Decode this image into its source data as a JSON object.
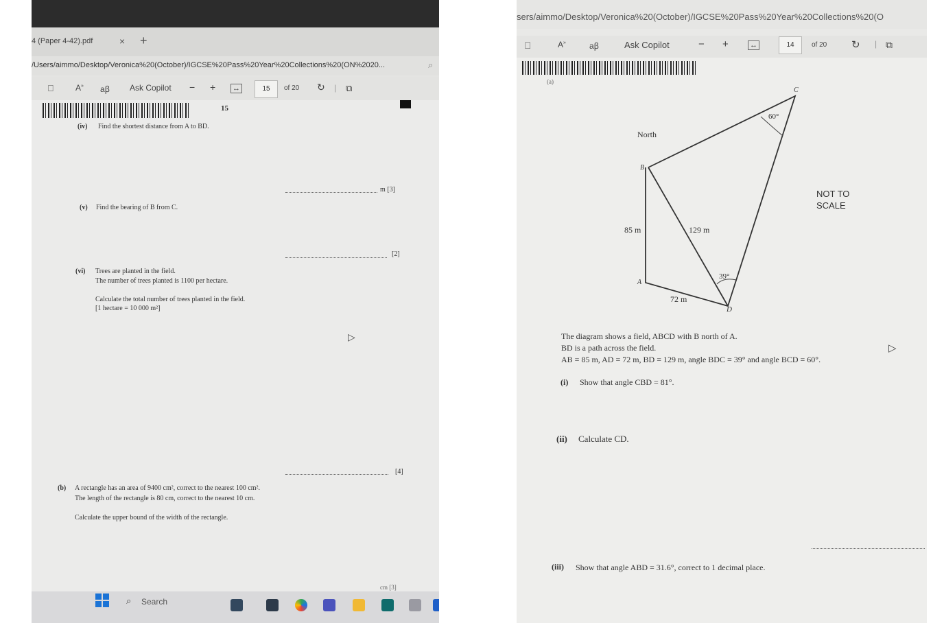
{
  "left": {
    "tab_title": "4 (Paper 4-42).pdf",
    "tab_close": "×",
    "new_tab": "+",
    "url": "/Users/aimmo/Desktop/Veronica%20(October)/IGCSE%20Pass%20Year%20Collections%20(ON%2020...",
    "toolbar": {
      "ask_copilot": "Ask Copilot",
      "zoom_out": "−",
      "zoom_in": "+",
      "page": "15",
      "of_pages": "of 20"
    },
    "page_number": "15",
    "q_iv_label": "(iv)",
    "q_iv_text": "Find the shortest distance from A to BD.",
    "q_iv_unit_marks": "m  [3]",
    "q_v_label": "(v)",
    "q_v_text": "Find the bearing of B from C.",
    "q_v_marks": "[2]",
    "q_vi_label": "(vi)",
    "q_vi_line1": "Trees are planted in the field.",
    "q_vi_line2": "The number of trees planted is 1100 per hectare.",
    "q_vi_line3": "Calculate the total number of trees planted in the field.",
    "q_vi_line4": "[1 hectare = 10 000 m²]",
    "q_vi_marks": "[4]",
    "q_b_label": "(b)",
    "q_b_line1": "A rectangle has an area of 9400 cm², correct to the nearest 100 cm².",
    "q_b_line2": "The length of the rectangle is 80 cm, correct to the nearest 10 cm.",
    "q_b_line3": "Calculate the upper bound of the width of the rectangle.",
    "q_b_unit_marks": "cm  [3]",
    "taskbar_search": "Search"
  },
  "right": {
    "url": "sers/aimmo/Desktop/Veronica%20(October)/IGCSE%20Pass%20Year%20Collections%20(O",
    "toolbar": {
      "ask_copilot": "Ask Copilot",
      "zoom_out": "−",
      "zoom_in": "+",
      "page": "14",
      "of_pages": "of 20"
    },
    "part_label": "(a)",
    "diagram": {
      "label_north": "North",
      "label_a": "A",
      "label_b": "B",
      "label_c": "C",
      "label_d": "D",
      "label_85": "85 m",
      "label_129": "129 m",
      "label_72": "72 m",
      "label_60": "60°",
      "label_39": "39°",
      "not_to_scale_1": "NOT TO",
      "not_to_scale_2": "SCALE"
    },
    "desc_line1": "The diagram shows a field, ABCD with B north of A.",
    "desc_line2": "BD is a path across the field.",
    "desc_line3": "AB = 85 m, AD = 72 m, BD = 129 m, angle BDC = 39° and angle BCD = 60°.",
    "q_i_label": "(i)",
    "q_i_text": "Show that angle CBD = 81°.",
    "q_ii_label": "(ii)",
    "q_ii_text": "Calculate CD.",
    "q_iii_label": "(iii)",
    "q_iii_text": "Show that angle ABD = 31.6°, correct to 1 decimal place."
  }
}
